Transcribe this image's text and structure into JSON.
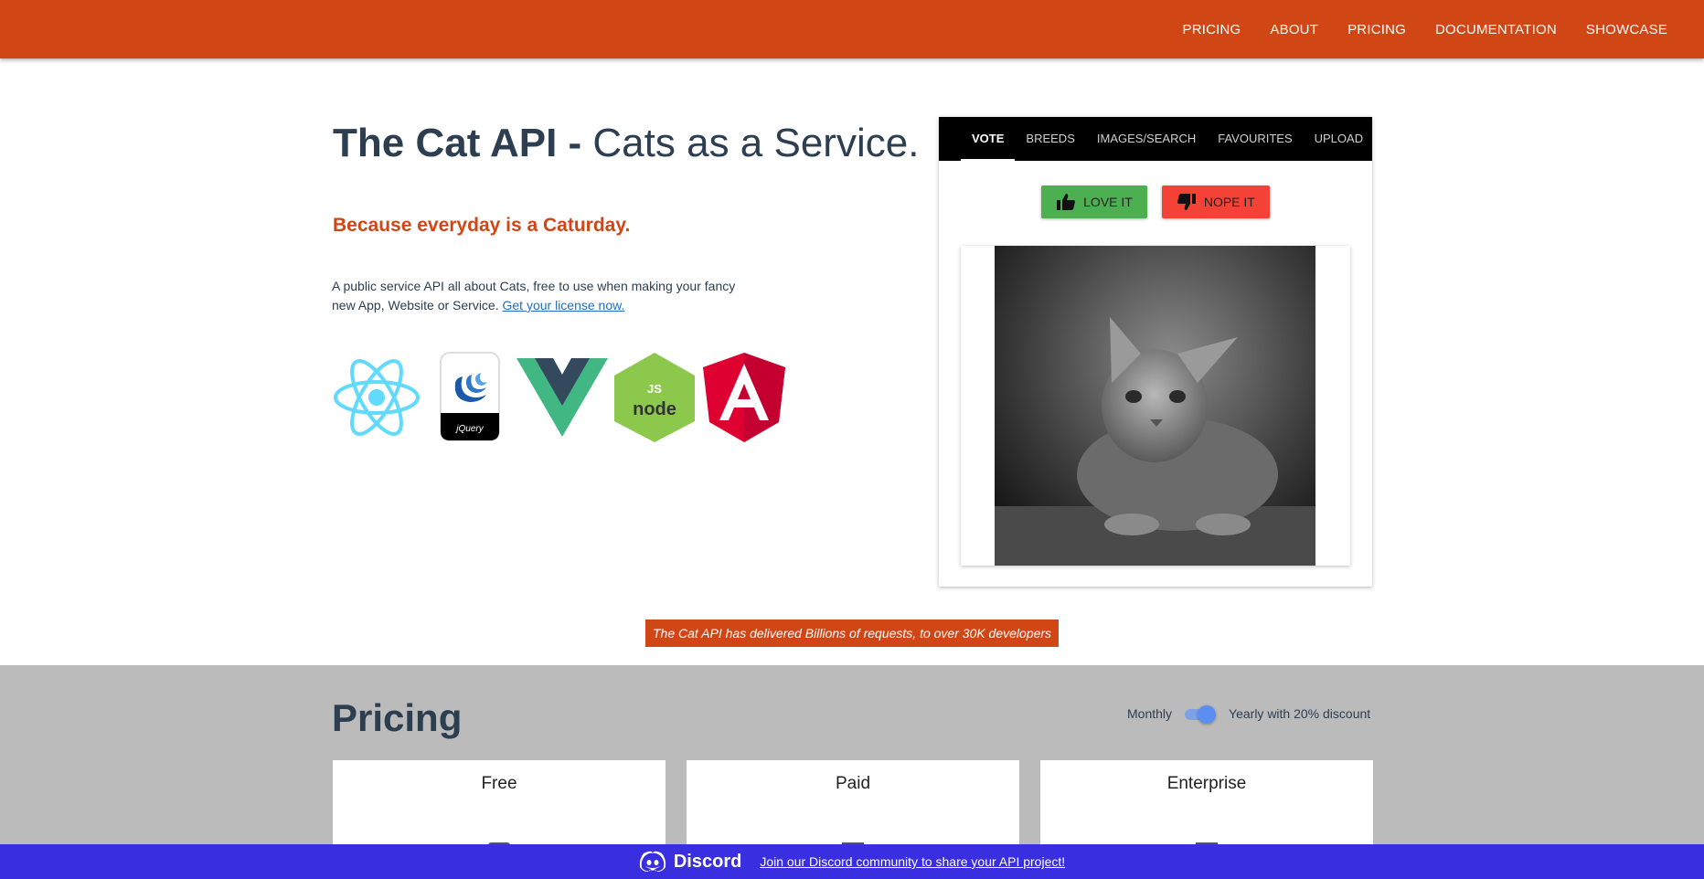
{
  "nav": {
    "items": [
      "PRICING",
      "ABOUT",
      "PRICING",
      "DOCUMENTATION",
      "SHOWCASE"
    ]
  },
  "hero": {
    "title_bold": "The Cat API -",
    "title_light": "Cats as a Service.",
    "tagline": "Because everyday is a Caturday.",
    "description": "A public service API all about Cats, free to use when making your fancy new App, Website or Service.",
    "license_link": "Get your license now.",
    "logos": [
      "react-logo",
      "jquery-logo",
      "vue-logo",
      "nodejs-logo",
      "angular-logo"
    ]
  },
  "panel": {
    "tabs": [
      "VOTE",
      "BREEDS",
      "IMAGES/SEARCH",
      "FAVOURITES",
      "UPLOAD"
    ],
    "active_tab": "VOTE",
    "love_label": "LOVE IT",
    "nope_label": "NOPE IT"
  },
  "banner": {
    "text": "The Cat API has delivered Billions of requests, to over 30K developers"
  },
  "pricing": {
    "title": "Pricing",
    "monthly_label": "Monthly",
    "yearly_label": "Yearly with 20% discount",
    "plans": [
      "Free",
      "Paid",
      "Enterprise"
    ]
  },
  "discord": {
    "brand": "Discord",
    "link": "Join our Discord community to share your API project!"
  },
  "colors": {
    "brand": "#d14615",
    "love": "#4caf50",
    "nope": "#f44336",
    "discord": "#3a2fe0"
  }
}
